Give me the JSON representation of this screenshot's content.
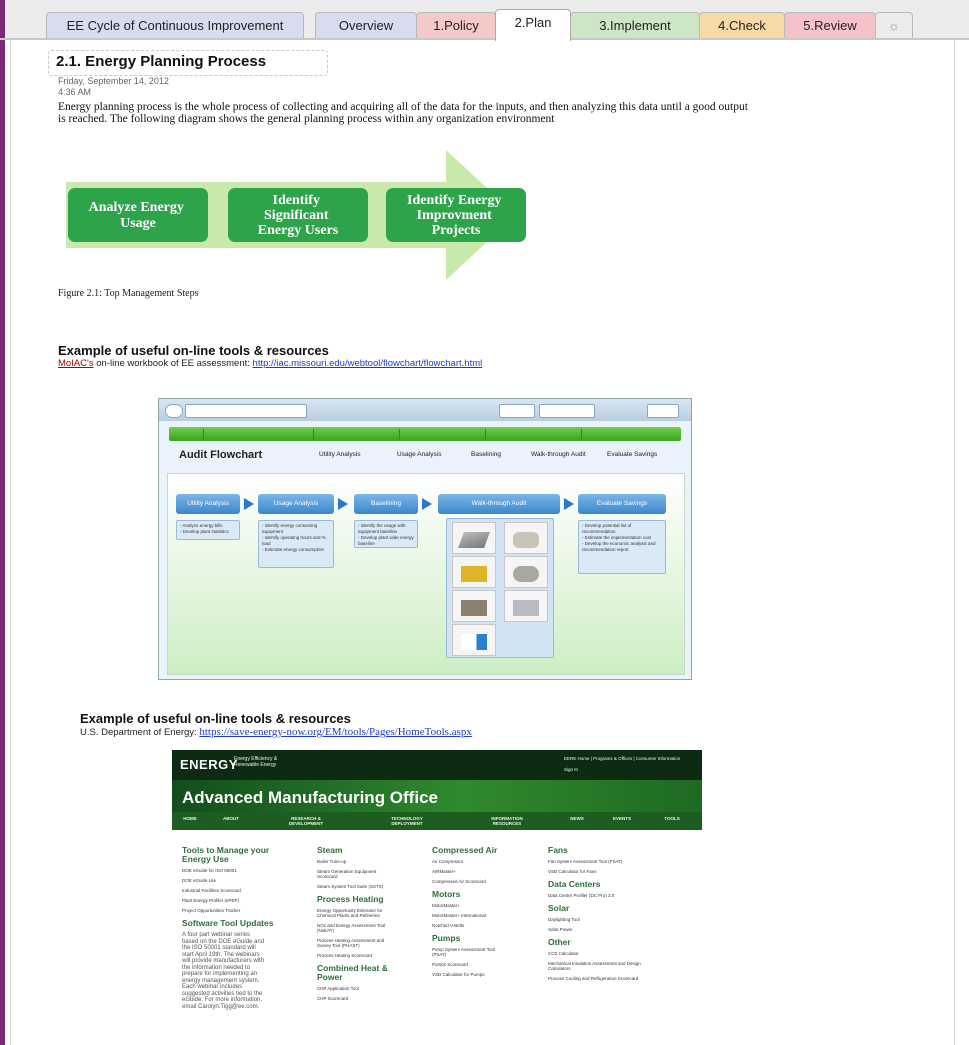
{
  "tabs": [
    {
      "label": "EE Cycle of Continuous Improvement",
      "color": "#d7ddee",
      "active": false
    },
    {
      "label": "Overview",
      "color": "#d7ddee",
      "active": false
    },
    {
      "label": "1.Policy",
      "color": "#f6c9c9",
      "active": false
    },
    {
      "label": "2.Plan",
      "color": "#ffffff",
      "active": true
    },
    {
      "label": "3.Implement",
      "color": "#cde6c6",
      "active": false
    },
    {
      "label": "4.Check",
      "color": "#f8d9a8",
      "active": false
    },
    {
      "label": "5.Review",
      "color": "#f6c2c9",
      "active": false
    },
    {
      "label": "☼",
      "color": "#ececec",
      "active": false,
      "icon": "new-section-icon"
    }
  ],
  "page": {
    "title": "2.1. Energy Planning Process",
    "date": "Friday, September 14, 2012",
    "time": "4:36 AM",
    "intro": "Energy planning process is the whole process of collecting and acquiring all of the data for the inputs, and then analyzing this data until a good output is reached. The following diagram shows the general planning process within any organization environment"
  },
  "diagram": {
    "steps": [
      "Analyze Energy Usage",
      "Identify Significant Energy Users",
      "Identify Energy Improvment Projects"
    ],
    "step_color": "#2ea44a",
    "arrow_color": "#c9e8ab",
    "caption": "Figure 2.1: Top Management Steps"
  },
  "section1": {
    "heading": "Example of useful on-line tools & resources",
    "org": "MoIAC's",
    "text": " on-line workbook of EE assessment:  ",
    "link": "http://iac.missouri.edu/webtool/flowchart/flowchart.html"
  },
  "audit": {
    "title": "Audit Flowchart",
    "nav": [
      "Utility Analysis",
      "Usage Analysis",
      "Baselining",
      "Walk-through Audit",
      "Evaluate Savings"
    ],
    "steps": [
      "Utility Analysis",
      "Usage Analysis",
      "Baselining",
      "Walk-through Audit",
      "Evaluate Savings"
    ],
    "notes": [
      [
        "- Analyze energy bills",
        "- Develop plant statistics"
      ],
      [
        "- Identify energy consuming equipment",
        "- Identify operating hours and % load",
        "- Estimate energy consumption"
      ],
      [
        "- Identify the usage with equipment baseline",
        "- Develop plant wide energy baseline"
      ],
      [],
      [
        "- Develop potential list of recommendation",
        "- Estimate the implementation cost",
        "- Develop the economic analysis and recommendation report"
      ]
    ],
    "thumbs": [
      "Lighting",
      "Motors",
      "Compressed Air",
      "Boilers",
      "Furnaces & Ovens",
      "HVAC",
      "Process Improvement"
    ]
  },
  "section2": {
    "heading": "Example of useful on-line tools & resources",
    "text": "U.S. Department of Energy: ",
    "link": "https://save-energy-now.org/EM/tools/Pages/HomeTools.aspx"
  },
  "doe": {
    "logo": "ENERGY",
    "logo_sub": "Energy Efficiency & Renewable Energy",
    "top_links": "EERE Home | Programs & Offices | Consumer Information",
    "sign_in": "Sign In",
    "office": "Advanced Manufacturing Office",
    "nav": [
      "HOME",
      "ABOUT",
      "RESEARCH & DEVELOPMENT",
      "TECHNOLOGY DEPLOYMENT",
      "INFORMATION RESOURCES",
      "NEWS",
      "EVENTS",
      "TOOLS"
    ],
    "columns": [
      {
        "sections": [
          {
            "heading": "Tools to Manage your Energy Use",
            "items": [
              "DOE eGuide for ISO 50001",
              "DOE eGuide Lite",
              "Industrial Facilities Scorecard",
              "Plant Energy Profiler (ePEP)",
              "Project Opportunities Tracker"
            ]
          },
          {
            "heading": "Software Tool Updates",
            "items": [],
            "paragraph": "A four part webinar series based on the DOE eGuide and the ISO 50001 standard will start April 19th. The webinars will provide manufacturers with the information needed to prepare for implementing an energy management system. Each webinar includes suggested activities tied to the eGuide. For more information, email Carolyn.Tigg@ee.com."
          }
        ]
      },
      {
        "sections": [
          {
            "heading": "Steam",
            "items": [
              "Boiler Tune-up",
              "Steam Generation Equipment Scorecard",
              "Steam System Tool Suite (SSTS)"
            ]
          },
          {
            "heading": "Process Heating",
            "items": [
              "Energy Opportunity Estimator for Chemical Plants and Refineries",
              "NOx and Energy Assessment Tool (NxEAT)",
              "Process Heating Assessment and Survey Tool (PHAST)",
              "Process Heating Scorecard"
            ]
          },
          {
            "heading": "Combined Heat & Power",
            "items": [
              "CHP Application Tool",
              "CHP Scorecard"
            ]
          }
        ]
      },
      {
        "sections": [
          {
            "heading": "Compressed Air",
            "items": [
              "Air Compressor",
              "AIRMaster+",
              "Compressed Air Scorecard"
            ]
          },
          {
            "heading": "Motors",
            "items": [
              "MotorMaster+",
              "MotorMaster+ International",
              "Notched V-Belts"
            ]
          },
          {
            "heading": "Pumps",
            "items": [
              "Pump System Assessment Tool (PSAT)",
              "Pumps Scorecard",
              "VSD Calculator for Pumps"
            ]
          }
        ]
      },
      {
        "sections": [
          {
            "heading": "Fans",
            "items": [
              "Fan System Assessment Tool (FSAT)",
              "VSD Calculator for Fans"
            ]
          },
          {
            "heading": "Data Centers",
            "items": [
              "Data Center Profiler (DC Pro) 3.0"
            ]
          },
          {
            "heading": "Solar",
            "items": [
              "Daylighting Tool",
              "Solar Power"
            ]
          },
          {
            "heading": "Other",
            "items": [
              "CO2 Calculator",
              "Mechanical Insulation Assessment and Design Calculators",
              "Process Cooling and Refrigeration Scorecard"
            ]
          }
        ]
      }
    ]
  }
}
